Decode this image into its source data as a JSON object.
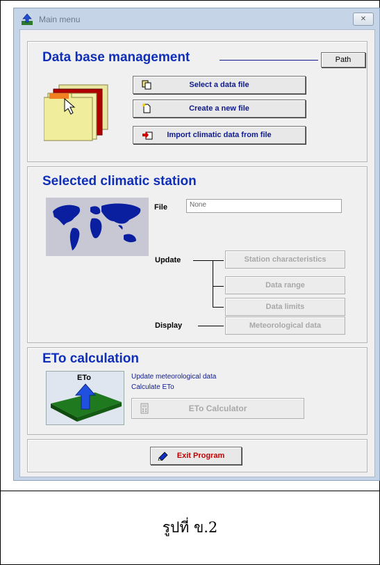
{
  "window": {
    "title": "Main menu",
    "close_label": "✕"
  },
  "database": {
    "heading": "Data base management",
    "path_label": "Path",
    "select_label": "Select a data file",
    "create_label": "Create a new file",
    "import_label": "Import climatic data from file"
  },
  "station": {
    "heading": "Selected climatic station",
    "file_label": "File",
    "file_value": "None",
    "update_label": "Update",
    "display_label": "Display",
    "station_characteristics": "Station characteristics",
    "data_range": "Data range",
    "data_limits": "Data limits",
    "meteorological_data": "Meteorological data"
  },
  "eto": {
    "heading": "ETo calculation",
    "image_label": "ETo",
    "line1": "Update meteorological data",
    "line2": "Calculate ETo",
    "calculator_label": "ETo Calculator"
  },
  "exit_label": "Exit Program",
  "caption": "รูปที่ ข.2",
  "colors": {
    "heading": "#0f2fb8",
    "window_frame": "#c5d5e7",
    "panel": "#f0f0f0"
  }
}
